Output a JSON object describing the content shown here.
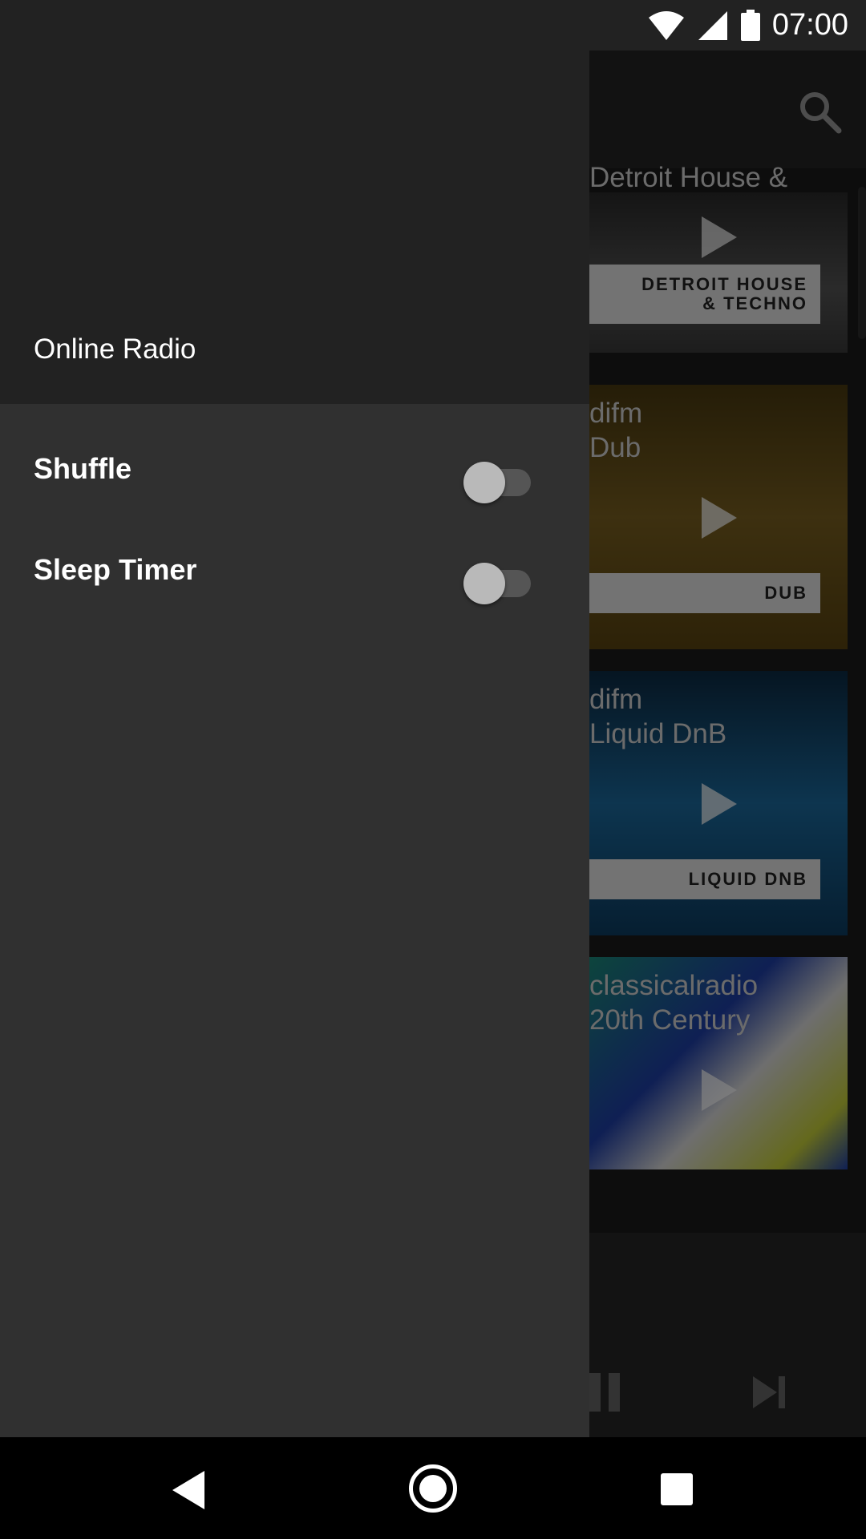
{
  "status_bar": {
    "time": "07:00",
    "icons": [
      "wifi-icon",
      "cell-signal-icon",
      "battery-icon"
    ]
  },
  "drawer": {
    "title": "Online Radio",
    "items": [
      {
        "label": "Shuffle",
        "toggle_on": false
      },
      {
        "label": "Sleep Timer",
        "toggle_on": false
      }
    ]
  },
  "background": {
    "cards": [
      {
        "title": "Detroit House &",
        "label": "DETROIT HOUSE\n& TECHNO",
        "art_color": "#3d3a36"
      },
      {
        "title": "difm\nDub",
        "label": "DUB",
        "art_color": "#6b5319"
      },
      {
        "title": "difm\nLiquid DnB",
        "label": "LIQUID DNB",
        "art_color": "#0f4f7a"
      },
      {
        "title": "classicalradio\n20th Century",
        "label": "",
        "art_color": "#1b3f8a"
      }
    ]
  },
  "nav_bar": {
    "icons": [
      "back-icon",
      "home-icon",
      "recents-icon"
    ]
  }
}
